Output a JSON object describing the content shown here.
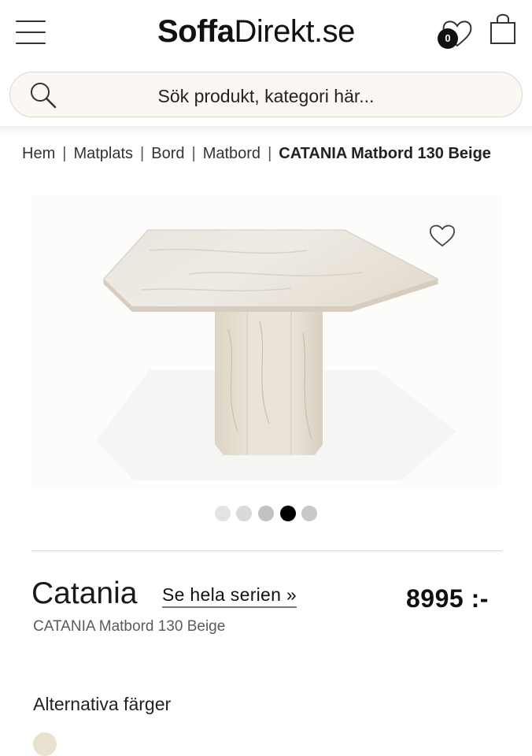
{
  "header": {
    "logo_bold": "Soffa",
    "logo_regular": "Direkt.se",
    "wishlist_count": "0",
    "icons": [
      "menu-icon",
      "heart-icon",
      "shopping-bag-icon"
    ]
  },
  "search": {
    "placeholder": "Sök produkt, kategori här..."
  },
  "breadcrumb": {
    "items": [
      "Hem",
      "Matplats",
      "Bord",
      "Matbord"
    ],
    "current": "CATANIA Matbord 130 Beige"
  },
  "gallery": {
    "image_icon": "octagonal-marble-dining-table",
    "total_images": 5,
    "active_index": 3,
    "dot_colors": [
      "#e3e3e3",
      "#d9d9d9",
      "#c2c2c2",
      "#000000",
      "#c9c9c9"
    ]
  },
  "product": {
    "series": "Catania",
    "series_link": "Se hela serien »",
    "price": "8995 :-",
    "name": "CATANIA Matbord 130 Beige"
  },
  "alternatives": {
    "heading": "Alternativa färger",
    "colors": [
      "#e8e1d0"
    ]
  },
  "colors": {
    "marble_light": "#ece7df",
    "marble_mid": "#dcd3c4",
    "marble_vein": "#b9ae9c",
    "search_border": "#ddd6cb"
  }
}
